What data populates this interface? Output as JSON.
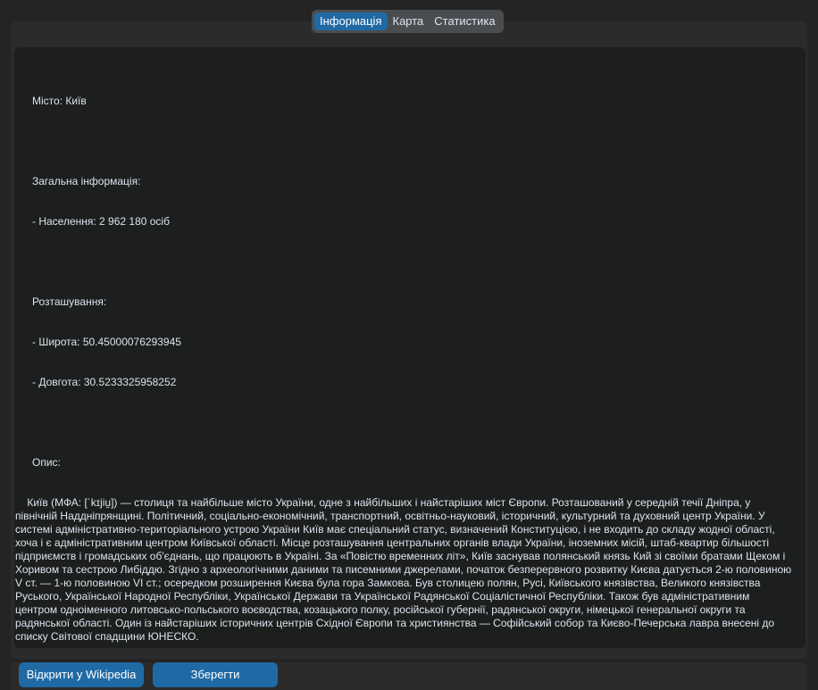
{
  "tabs": [
    {
      "label": "Інформація",
      "active": true
    },
    {
      "label": "Карта",
      "active": false
    },
    {
      "label": "Статистика",
      "active": false
    }
  ],
  "info": {
    "city_line": "Місто: Київ",
    "general_heading": "Загальна інформація:",
    "population_line": "- Населення: 2 962 180 осіб",
    "location_heading": "Розташування:",
    "latitude_line": "- Широта: 50.45000076293945",
    "longitude_line": "- Довгота: 30.5233325958252",
    "description_heading": "Опис:",
    "description": "    Київ (МФА: [ˈkɪjiu̯]) — столиця та найбільше місто України, одне з найбільших і найстаріших міст Європи. Розташований у середній течії Дніпра, у північній Наддніпрянщині. Політичний, соціально-економічний, транспортний, освітньо-науковий, історичний, культурний та духовний центр України. У системі адміністративно-територіального устрою України Київ має спеціальний статус, визначений Конституцією, і не входить до складу жодної області, хоча і є адміністративним центром Київської області. Місце розташування центральних органів влади України, іноземних місій, штаб-квартир більшості підприємств і громадських об'єднань, що працюють в Україні. За «Повістю временних літ», Київ заснував полянський князь Кий зі своїми братами Щеком і Хоривом та сестрою Либіддю. Згідно з археологічними даними та писемними джерелами, початок безперервного розвитку Києва датується 2-ю половиною V ст. — 1-ю половиною VI ст.; осередком розширення Києва була гора Замкова. Був столицею полян, Русі, Київського князівства, Великого князівства Руського, Української Народної Республіки, Української Держави та Української Радянської Соціалістичної Республіки. Також був адміністративним центром одноіменного литовсько-польського воєводства, козацького полку, російської губернії, радянської округи, німецької генеральної округи та радянської області. Один із найстаріших історичних центрів Східної Європи та християнства — Софійський собор та Києво-Печерська лавра внесені до списку Світової спадщини ЮНЕСКО."
  },
  "buttons": {
    "wikipedia_label": "Відкрити у Wikipedia",
    "save_label": "Зберегти"
  },
  "colors": {
    "accent": "#1f6aa5",
    "background": "#242424",
    "panel": "#2b2b2b",
    "textbox": "#1d1e1e",
    "text": "#dce4ee"
  }
}
